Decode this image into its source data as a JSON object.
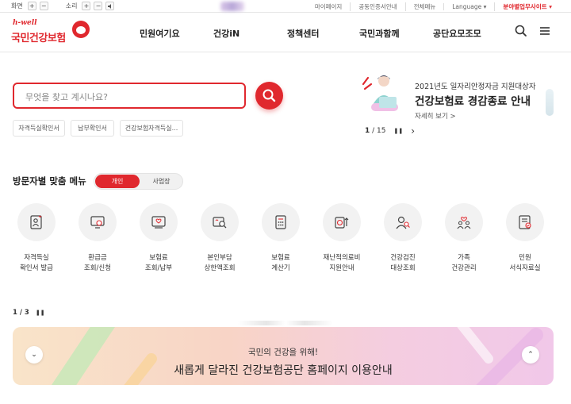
{
  "util": {
    "screen_label": "화면",
    "sound_label": "소리",
    "plus": "+",
    "minus": "−",
    "right_links": [
      "마이페이지",
      "공동인증서안내",
      "전체메뉴",
      "Language ▾",
      "분야별업무사이트 ▾"
    ]
  },
  "logo": {
    "tagline": "h-well",
    "name": "국민건강보험"
  },
  "nav": {
    "items": [
      "민원여기요",
      "건강iN",
      "정책센터",
      "국민과함께",
      "공단요모조모"
    ]
  },
  "search": {
    "placeholder": "무엇을 찾고 계시나요?",
    "quick_links": [
      "자격득실확인서",
      "납부확인서",
      "건강보험자격득실..."
    ]
  },
  "banner": {
    "subtitle": "2021년도 일자리안정자금 지원대상자",
    "title": "건강보험료 경감종료 안내",
    "more": "자세히 보기 >",
    "current": "1",
    "total": "/ 15",
    "pause": "❚❚",
    "next": "›"
  },
  "visitor": {
    "title": "방문자별 맞춤 메뉴",
    "tabs": [
      "개인",
      "사업장"
    ],
    "menu": [
      {
        "line1": "자격득실",
        "line2": "확인서 발급"
      },
      {
        "line1": "환급금",
        "line2": "조회/신청"
      },
      {
        "line1": "보험료",
        "line2": "조회/납부"
      },
      {
        "line1": "본인부담",
        "line2": "상한액조회"
      },
      {
        "line1": "보험료",
        "line2": "계산기"
      },
      {
        "line1": "재난적의료비",
        "line2": "지원안내"
      },
      {
        "line1": "건강검진",
        "line2": "대상조회"
      },
      {
        "line1": "가족",
        "line2": "건강관리"
      },
      {
        "line1": "민원",
        "line2": "서식자료실"
      }
    ]
  },
  "slider2": {
    "current": "1 / 3",
    "pause": "❚❚"
  },
  "bottom_banner": {
    "line1": "국민의 건강을 위해!",
    "line2": "새롭게 달라진 건강보험공단 홈페이지 이용안내",
    "down": "⌄",
    "up": "⌃"
  },
  "colors": {
    "brand_red": "#e0282e"
  }
}
